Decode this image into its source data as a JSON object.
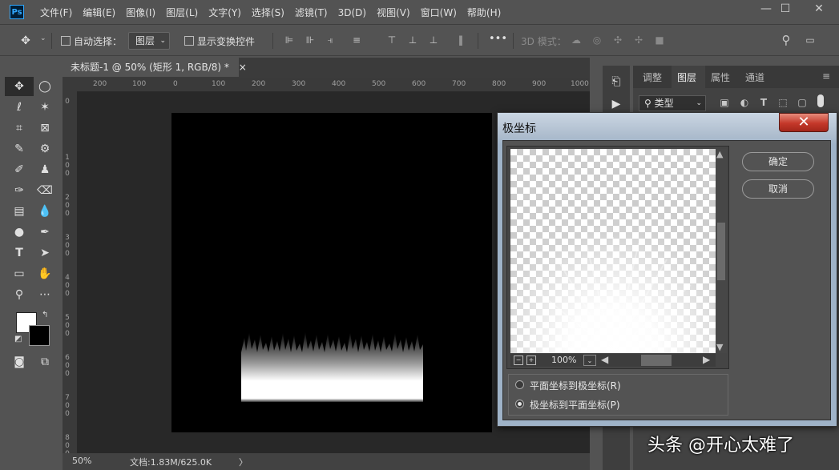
{
  "app": {
    "logo": "Ps"
  },
  "menu": [
    "文件(F)",
    "编辑(E)",
    "图像(I)",
    "图层(L)",
    "文字(Y)",
    "选择(S)",
    "滤镜(T)",
    "3D(D)",
    "视图(V)",
    "窗口(W)",
    "帮助(H)"
  ],
  "window_controls": {
    "minimize": "—",
    "maximize": "☐",
    "close": "✕"
  },
  "options_bar": {
    "auto_select_label": "自动选择：",
    "auto_select_checked": false,
    "layer_select_value": "图层",
    "transform_controls_label": "显示变换控件",
    "more_label": "•••",
    "mode_3d_label": "3D 模式："
  },
  "document_tab": {
    "title": "未标题-1 @ 50% (矩形 1, RGB/8) *",
    "close": "×"
  },
  "ruler_h_ticks": [
    "200",
    "100",
    "0",
    "100",
    "200",
    "300",
    "400",
    "500",
    "600",
    "700",
    "800",
    "900",
    "1000"
  ],
  "ruler_v_ticks": [
    "0",
    "1\n0\n0",
    "2\n0\n0",
    "3\n0\n0",
    "4\n0\n0",
    "5\n0\n0",
    "6\n0\n0",
    "7\n0\n0",
    "8\n0\n0"
  ],
  "status_bar": {
    "zoom": "50%",
    "doc_info": "文档:1.83M/625.0K",
    "arrow": "〉"
  },
  "right_panel": {
    "tabs": [
      "调整",
      "图层",
      "属性",
      "通道"
    ],
    "active_tab": "图层",
    "kind_filter": "类型"
  },
  "dialog": {
    "title": "极坐标",
    "close": "✕",
    "ok_label": "确定",
    "cancel_label": "取消",
    "zoom": "100%",
    "options": [
      {
        "label": "平面坐标到极坐标(R)",
        "selected": false
      },
      {
        "label": "极坐标到平面坐标(P)",
        "selected": true
      }
    ]
  },
  "watermark": "头条 @开心太难了",
  "colors": {
    "foreground": "#ffffff",
    "background": "#000000",
    "accent": "#31a8ff",
    "close_button": "#c4382a"
  }
}
